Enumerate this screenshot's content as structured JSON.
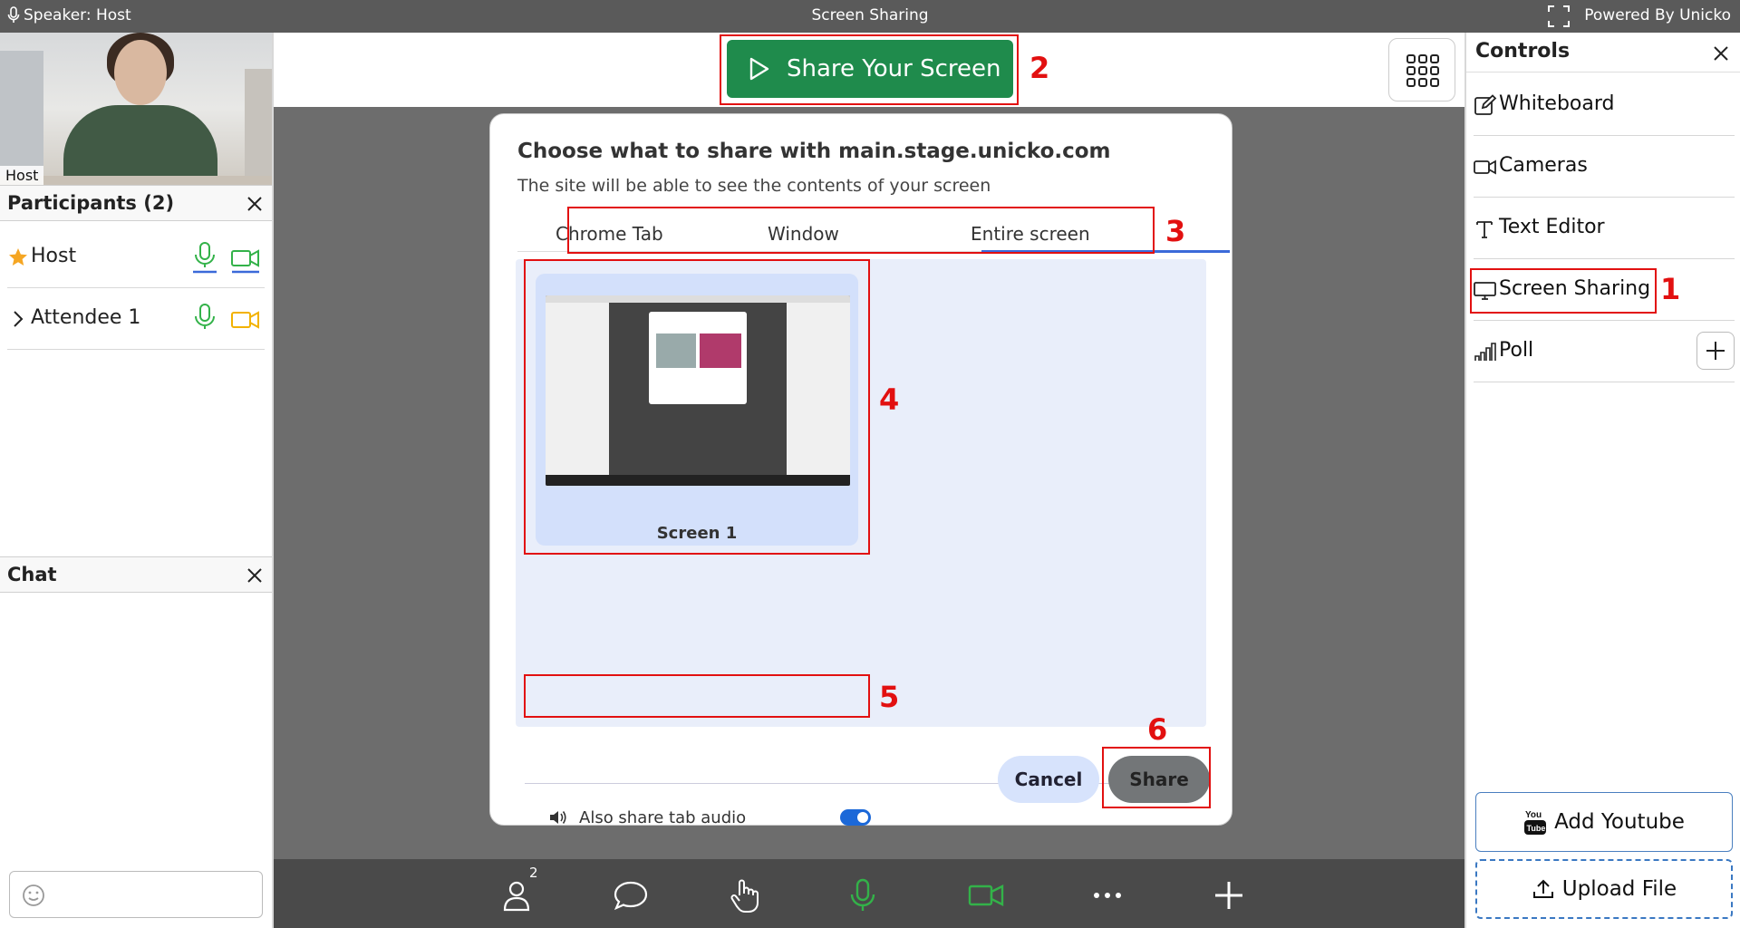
{
  "topbar": {
    "speaker": "Speaker: Host",
    "title": "Screen Sharing",
    "powered": "Powered By Unicko"
  },
  "video": {
    "label": "Host"
  },
  "participants": {
    "title": "Participants (2)",
    "items": [
      {
        "name": "Host",
        "role": "star-icon"
      },
      {
        "name": "Attendee 1",
        "role": "chevron-right-icon"
      }
    ]
  },
  "chat": {
    "title": "Chat"
  },
  "main": {
    "share_button": "Share Your Screen",
    "dialog": {
      "title": "Choose what to share with main.stage.unicko.com",
      "subtitle": "The site will be able to see the contents of your screen",
      "tabs": [
        "Chrome Tab",
        "Window",
        "Entire screen"
      ],
      "active_tab": "Entire screen",
      "screen_label": "Screen 1",
      "audio_label": "Also share tab audio",
      "audio_enabled": true,
      "cancel": "Cancel",
      "share": "Share"
    },
    "participants_badge": "2"
  },
  "controls": {
    "title": "Controls",
    "items": [
      "Whiteboard",
      "Cameras",
      "Text Editor",
      "Screen Sharing",
      "Poll"
    ],
    "add_youtube": "Add Youtube",
    "upload_file": "Upload File"
  },
  "annotations": [
    "1",
    "2",
    "3",
    "4",
    "5",
    "6"
  ],
  "colors": {
    "accent_green": "#1f8b4c",
    "annotation_red": "#e21010",
    "toggle_blue": "#1b68d8",
    "mic_green": "#33b249",
    "cam_orange": "#f2b200"
  }
}
